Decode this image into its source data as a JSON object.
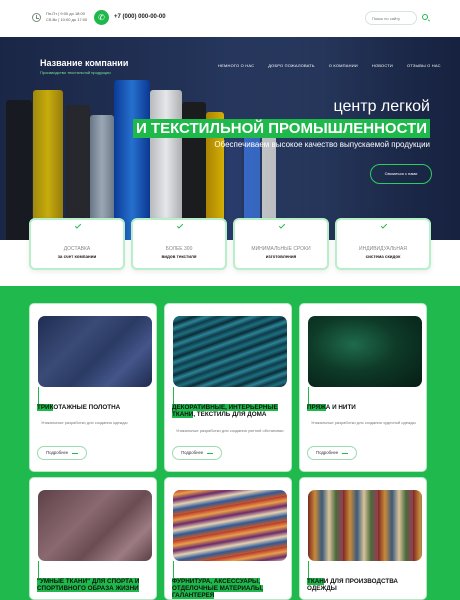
{
  "header": {
    "hours_line1": "Пн-Пт | 9:00 до 18:00",
    "hours_line2": "Сб-Вс | 10:00 до 17:00",
    "phone": "+7 (000) 000-00-00",
    "search_placeholder": "Поиск по сайту",
    "icons": [
      "clock-icon",
      "phone-icon",
      "search-icon"
    ]
  },
  "hero": {
    "company_name": "Название компании",
    "company_tagline": "Производство текстильной продукции",
    "nav": [
      "НЕМНОГО О НАС",
      "ДОБРО ПОЖАЛОВАТЬ",
      "О КОМПАНИИ",
      "НОВОСТИ",
      "ОТЗЫВЫ О НАС"
    ],
    "line1": "центр легкой",
    "line2": "И ТЕКСТИЛЬНОЙ ПРОМЫШЛЕННОСТИ",
    "line3": "Обеспечиваем высокое качество выпускаемой продукции",
    "button": "Связаться с нами"
  },
  "features": [
    {
      "top": "ДОСТАВКА",
      "bottom": "за счет компании"
    },
    {
      "top": "БОЛЕЕ 300",
      "bottom": "видов текстиля"
    },
    {
      "top": "МИНИМАЛЬНЫЕ СРОКИ",
      "bottom": "изготовления"
    },
    {
      "top": "ИНДИВИДУАЛЬНАЯ",
      "bottom": "система скидок"
    }
  ],
  "products": [
    {
      "hl": "ТРИК",
      "title": "ОТАЖНЫЕ ПОЛОТНА",
      "desc": "Уникальные разработки для создания одежды",
      "more": "Подробнее"
    },
    {
      "hl": "ДЕКОРАТИВНЫЕ, ИНТЕРЬЕРНЫЕ ТКАНИ",
      "title": ", ТЕКСТИЛЬ ДЛЯ ДОМА",
      "desc": "Уникальные разработки для создания уютной обстановки",
      "more": "Подробнее"
    },
    {
      "hl": "ПРЯЖ",
      "title": "А И НИТИ",
      "desc": "Уникальные разработки для создания чудесной одежды",
      "more": "Подробнее"
    },
    {
      "hl": "\"УМНЫЕ ТКАНИ\" ДЛЯ СПОРТА И СПОРТИВНОГО ОБРАЗА ЖИЗНИ",
      "title": "",
      "desc": "",
      "more": ""
    },
    {
      "hl": "ФУРНИТУРА, АКСЕССУАРЫ, ОТДЕЛОЧНЫЕ МАТЕРИАЛЫ, ГАЛАНТЕРЕЯ",
      "title": "",
      "desc": "",
      "more": ""
    },
    {
      "hl": "ТКАН",
      "title": "И ДЛЯ ПРОИЗВОДСТВА ОДЕЖДЫ",
      "desc": "",
      "more": ""
    }
  ],
  "colors": {
    "accent": "#1fb94b",
    "hero_bg": "#24345a"
  }
}
